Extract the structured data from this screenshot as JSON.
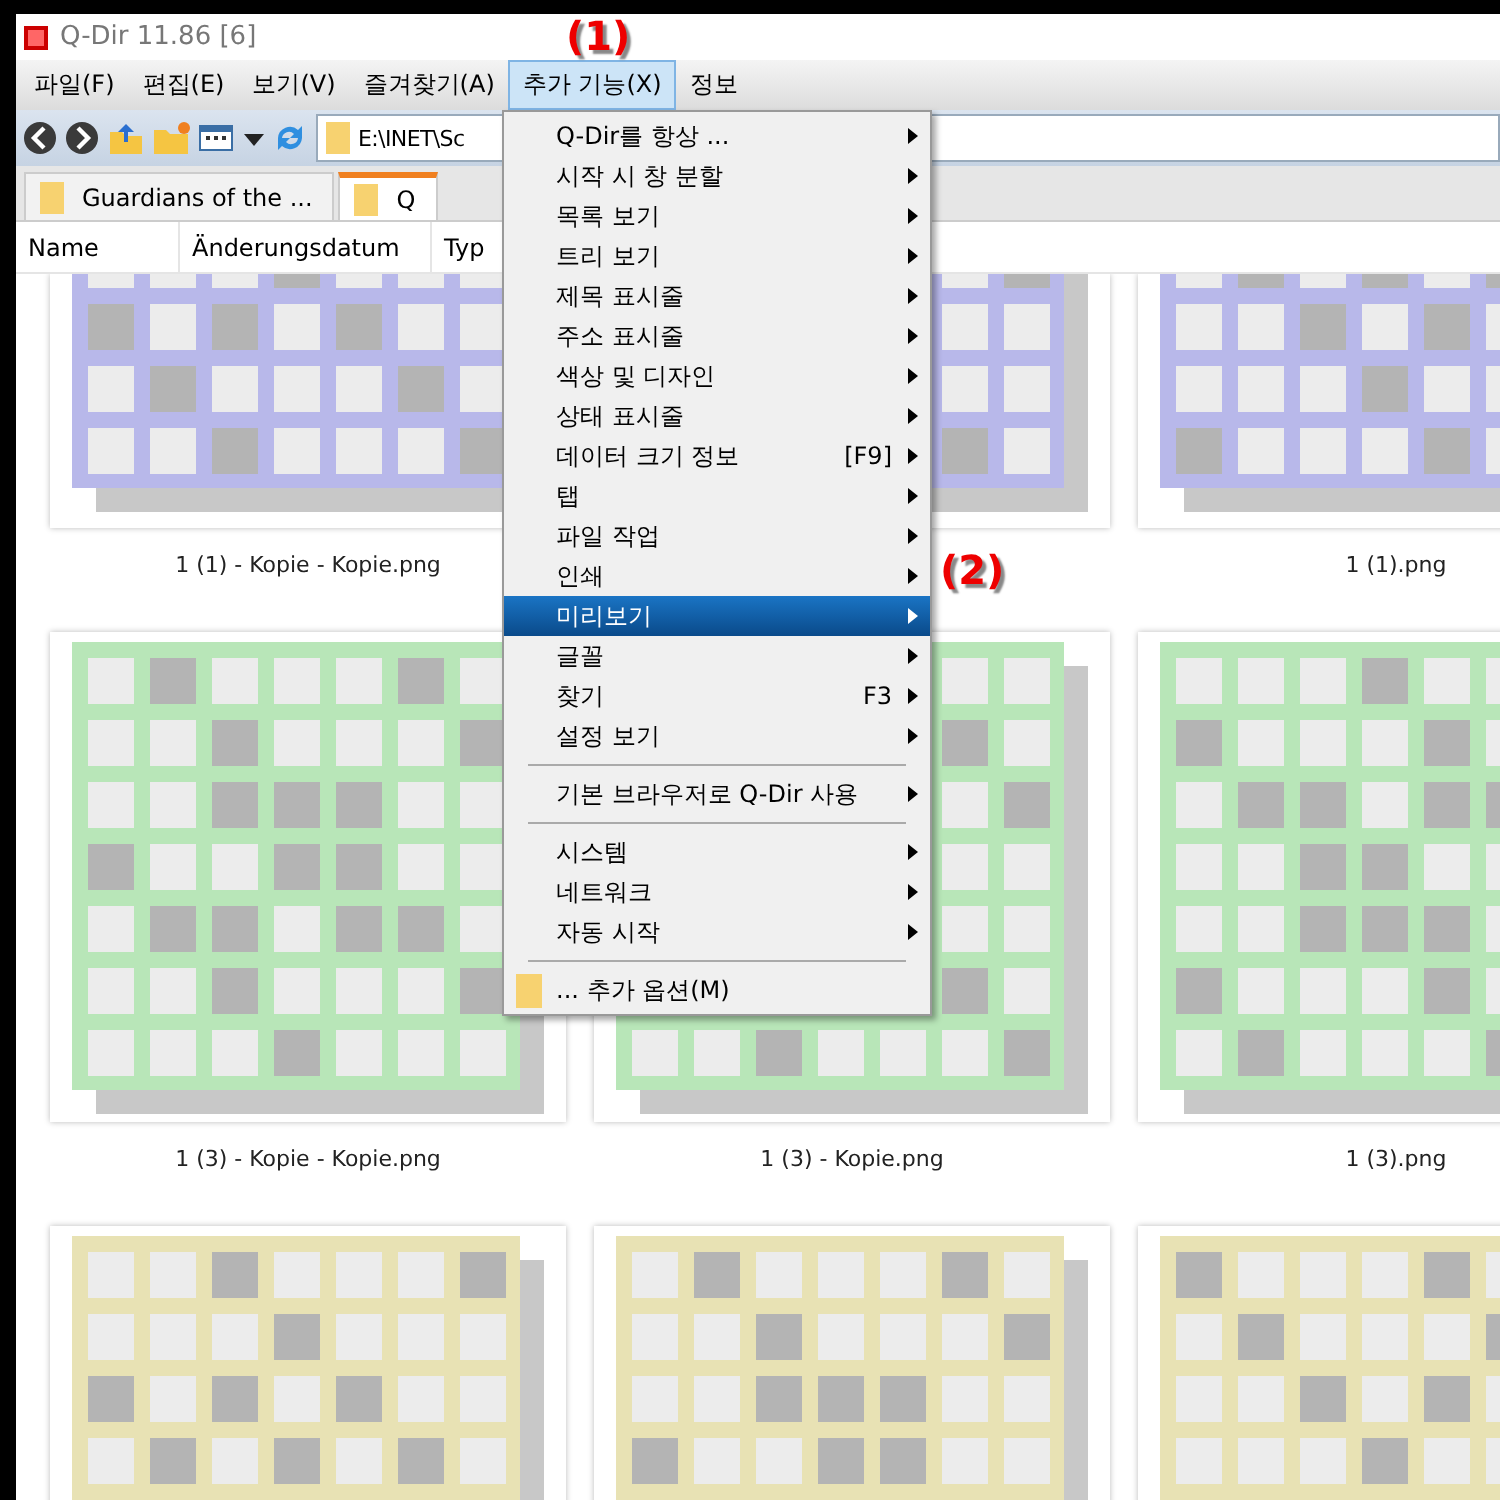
{
  "window": {
    "title": "Q-Dir 11.86 [6]"
  },
  "menubar": [
    {
      "label": "파일(F)",
      "selected": false
    },
    {
      "label": "편집(E)",
      "selected": false
    },
    {
      "label": "보기(V)",
      "selected": false
    },
    {
      "label": "즐겨찾기(A)",
      "selected": false
    },
    {
      "label": "추가 기능(X)",
      "selected": true
    },
    {
      "label": "정보",
      "selected": false
    }
  ],
  "address": {
    "value": "E:\\INET\\Sc"
  },
  "tabs": [
    {
      "label": "Guardians of the ...",
      "selected": false
    },
    {
      "label": "Q",
      "selected": true
    }
  ],
  "columns": [
    "Name",
    "Änderungsdatum",
    "Typ"
  ],
  "files": [
    {
      "name": "1 (1) - Kopie - Kopie.png",
      "color": "#b8b8ea"
    },
    {
      "color": "#b8b8ea"
    },
    {
      "name": "1 (1).png",
      "color": "#b8b8ea"
    },
    {
      "name": "1 (3) - Kopie - Kopie.png",
      "color": "#b8e6b8"
    },
    {
      "name": "1 (3) - Kopie.png",
      "color": "#b8e6b8"
    },
    {
      "name": "1 (3).png",
      "color": "#b8e6b8"
    },
    {
      "color": "#e8e2b4"
    },
    {
      "color": "#e8e2b4"
    },
    {
      "color": "#e8e2b4"
    }
  ],
  "menu": [
    {
      "kind": "item",
      "label": "Q-Dir를 항상 ...",
      "submenu": true,
      "selected": false
    },
    {
      "kind": "item",
      "label": "시작 시 창 분할",
      "submenu": true,
      "selected": false
    },
    {
      "kind": "item",
      "label": "목록 보기",
      "submenu": true,
      "selected": false
    },
    {
      "kind": "item",
      "label": "트리 보기",
      "submenu": true,
      "selected": false
    },
    {
      "kind": "item",
      "label": "제목 표시줄",
      "submenu": true,
      "selected": false
    },
    {
      "kind": "item",
      "label": "주소 표시줄",
      "submenu": true,
      "selected": false
    },
    {
      "kind": "item",
      "label": "색상 및 디자인",
      "submenu": true,
      "selected": false
    },
    {
      "kind": "item",
      "label": "상태 표시줄",
      "submenu": true,
      "selected": false
    },
    {
      "kind": "item",
      "label": "데이터 크기 정보",
      "shortcut": "[F9]",
      "submenu": true,
      "selected": false
    },
    {
      "kind": "item",
      "label": "탭",
      "submenu": true,
      "selected": false
    },
    {
      "kind": "item",
      "label": "파일 작업",
      "submenu": true,
      "selected": false
    },
    {
      "kind": "item",
      "label": "인쇄",
      "submenu": true,
      "selected": false
    },
    {
      "kind": "item",
      "label": "미리보기",
      "submenu": true,
      "selected": true
    },
    {
      "kind": "item",
      "label": "글꼴",
      "submenu": true,
      "selected": false
    },
    {
      "kind": "item",
      "label": "찾기",
      "shortcut": "F3",
      "submenu": true,
      "selected": false
    },
    {
      "kind": "item",
      "label": "설정 보기",
      "submenu": true,
      "selected": false
    },
    {
      "kind": "separator"
    },
    {
      "kind": "item",
      "label": "기본 브라우저로 Q-Dir 사용",
      "submenu": true,
      "selected": false
    },
    {
      "kind": "separator"
    },
    {
      "kind": "item",
      "label": "시스템",
      "submenu": true,
      "selected": false
    },
    {
      "kind": "item",
      "label": "네트워크",
      "submenu": true,
      "selected": false
    },
    {
      "kind": "item",
      "label": "자동 시작",
      "submenu": true,
      "selected": false
    },
    {
      "kind": "separator"
    },
    {
      "kind": "folder",
      "label": "... 추가 옵션(M)",
      "submenu": false,
      "selected": false
    }
  ],
  "annotations": [
    "(1)",
    "(2)"
  ]
}
